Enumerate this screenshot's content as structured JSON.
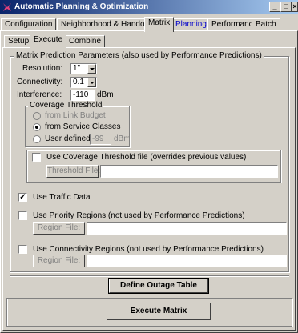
{
  "window": {
    "title": "Automatic Planning & Optimization",
    "buttons": [
      "_",
      "□",
      "×"
    ]
  },
  "tabs": [
    {
      "label": "Configuration"
    },
    {
      "label": "Neighborhood & Handoff"
    },
    {
      "label": "Matrix"
    },
    {
      "label": "Planning"
    },
    {
      "label": "Performance"
    },
    {
      "label": "Batch"
    }
  ],
  "subtabs": [
    {
      "label": "Setup"
    },
    {
      "label": "Execute"
    },
    {
      "label": "Combine"
    }
  ],
  "matrix_params": {
    "legend": "Matrix Prediction Parameters (also used by Performance Predictions)",
    "resolution_label": "Resolution:",
    "resolution_value": "1\"",
    "connectivity_label": "Connectivity:",
    "connectivity_value": "0.1",
    "interference_label": "Interference:",
    "interference_value": "-110",
    "interference_unit": "dBm"
  },
  "coverage_threshold": {
    "legend": "Coverage Threshold",
    "from_link_budget": "from Link Budget",
    "from_service_classes": "from Service Classes",
    "user_defined": "User defined:",
    "user_defined_value": "-99",
    "user_defined_unit": "dBm",
    "selected": "from_service_classes"
  },
  "threshold_file": {
    "checkbox_label": "Use Coverage Threshold file (overrides previous values)",
    "checked": false,
    "button_label": "Threshold File:",
    "path": ""
  },
  "traffic": {
    "label": "Use Traffic Data",
    "checked": true
  },
  "priority_regions": {
    "label": "Use Priority Regions (not used by Performance Predictions)",
    "checked": false,
    "button_label": "Region File:",
    "path": ""
  },
  "connectivity_regions": {
    "label": "Use Connectivity Regions (not used by Performance Predictions)",
    "checked": false,
    "button_label": "Region File:",
    "path": ""
  },
  "actions": {
    "define_outage": "Define Outage Table",
    "execute_matrix": "Execute Matrix"
  },
  "colors": {
    "title_start": "#0a246a",
    "title_end": "#a6caf0",
    "face": "#d4d0c8",
    "link_tab": "#0000cc",
    "app_icon": "#c03060"
  }
}
